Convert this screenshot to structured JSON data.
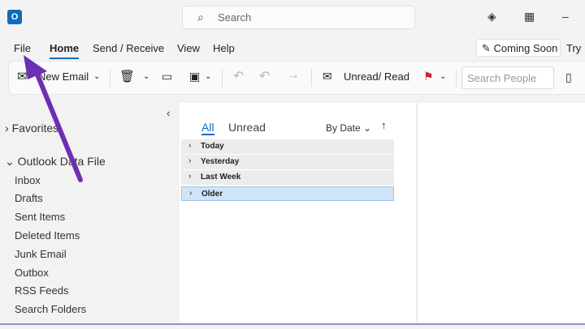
{
  "titlebar": {
    "app_icon": "O",
    "search_placeholder": "Search",
    "icons": [
      "search-icon",
      "diamond-icon",
      "grid-icon",
      "minimize-icon"
    ],
    "minimize_glyph": "–"
  },
  "ribbon": {
    "tabs": [
      "File",
      "Home",
      "Send / Receive",
      "View",
      "Help"
    ],
    "active_tab": "Home",
    "coming_soon": "Coming Soon",
    "try": "Try"
  },
  "toolbar": {
    "new_email": "New Email",
    "unread_read": "Unread/ Read",
    "search_people_placeholder": "Search People"
  },
  "nav": {
    "collapse_glyph": "‹",
    "favorites": "Favorites",
    "data_file": "Outlook Data File",
    "folders": [
      "Inbox",
      "Drafts",
      "Sent Items",
      "Deleted Items",
      "Junk Email",
      "Outbox",
      "RSS Feeds",
      "Search Folders"
    ]
  },
  "list": {
    "filter_all": "All",
    "filter_unread": "Unread",
    "sort": "By Date",
    "groups": [
      "Today",
      "Yesterday",
      "Last Week",
      "Older"
    ],
    "selected_group": "Older"
  },
  "annotation": {
    "arrow_color": "#6b2fb3"
  }
}
